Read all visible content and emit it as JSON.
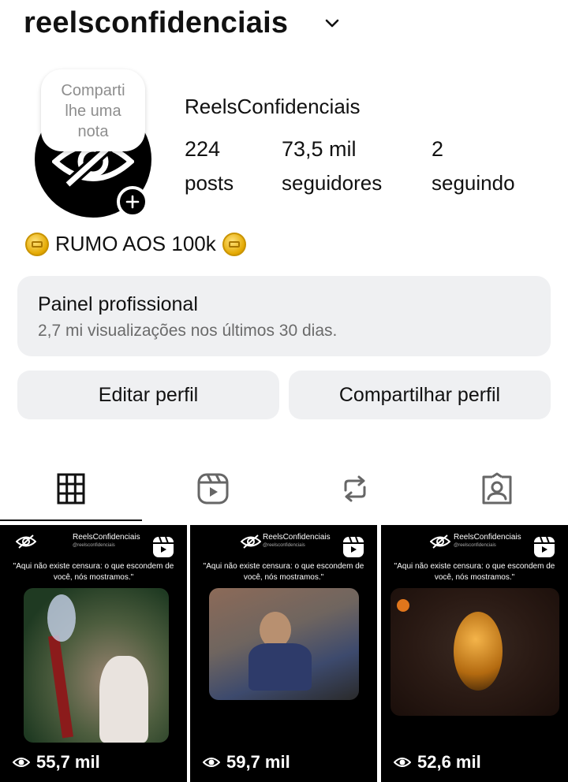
{
  "header": {
    "username": "reelsconfidenciais"
  },
  "note": {
    "line1": "Comparti",
    "line2": "lhe uma",
    "line3": "nota"
  },
  "profile": {
    "display_name": "ReelsConfidenciais",
    "stats": [
      {
        "value": "224",
        "label": "posts"
      },
      {
        "value": "73,5 mil",
        "label": "seguidores"
      },
      {
        "value": "2",
        "label": "seguindo"
      }
    ],
    "bio": "RUMO AOS 100k"
  },
  "panel": {
    "title": "Painel profissional",
    "subtitle": "2,7 mi visualizações nos últimos 30 dias."
  },
  "buttons": {
    "edit": "Editar perfil",
    "share": "Compartilhar perfil"
  },
  "tabs": [
    "grid-icon",
    "reels-icon",
    "reposts-icon",
    "tagged-icon"
  ],
  "posts": [
    {
      "brand": "ReelsConfidenciais",
      "handle": "@reelsconfidenciais",
      "quote": "\"Aqui não existe censura: o que escondem de você, nós mostramos.\"",
      "views": "55,7 mil"
    },
    {
      "brand": "ReelsConfidenciais",
      "handle": "@reelsconfidenciais",
      "quote": "\"Aqui não existe censura: o que escondem de você, nós mostramos.\"",
      "views": "59,7 mil"
    },
    {
      "brand": "ReelsConfidenciais",
      "handle": "@reelsconfidenciais",
      "quote": "\"Aqui não existe censura: o que escondem de você, nós mostramos.\"",
      "views": "52,6 mil"
    }
  ]
}
